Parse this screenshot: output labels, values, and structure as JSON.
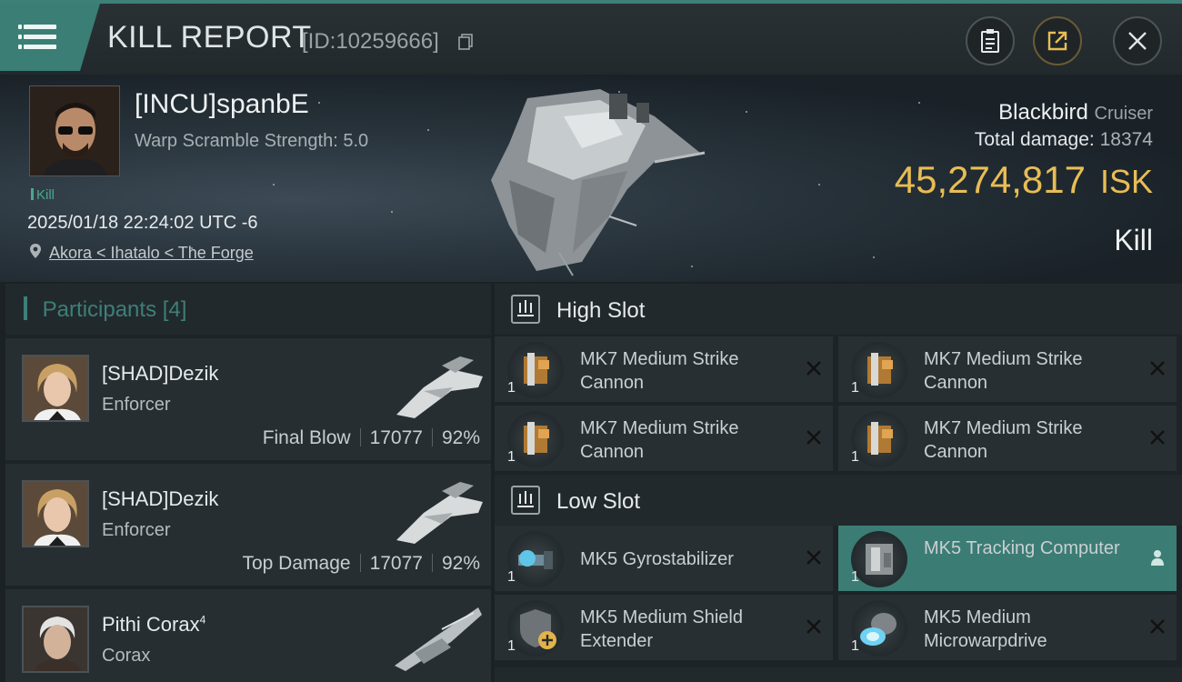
{
  "header": {
    "title": "KILL REPORT",
    "report_id": "[ID:10259666]"
  },
  "victim": {
    "name": "[INCU]spanbE",
    "scram": "Warp Scramble Strength: 5.0",
    "tag": "Kill",
    "timestamp": "2025/01/18 22:24:02 UTC -6",
    "location": "Akora < Ihatalo < The Forge",
    "ship": "Blackbird",
    "ship_class": "Cruiser",
    "total_damage_label": "Total damage:",
    "total_damage": "18374",
    "isk_value": "45,274,817",
    "isk_unit": "ISK",
    "result": "Kill"
  },
  "participants": {
    "label": "Participants",
    "count": "[4]",
    "items": [
      {
        "name": "[SHAD]Dezik",
        "sup": "",
        "ship": "Enforcer",
        "role": "Final Blow",
        "damage": "17077",
        "pct": "92%"
      },
      {
        "name": "[SHAD]Dezik",
        "sup": "",
        "ship": "Enforcer",
        "role": "Top Damage",
        "damage": "17077",
        "pct": "92%"
      },
      {
        "name": "Pithi Corax",
        "sup": "4",
        "ship": "Corax",
        "role": "",
        "damage": "",
        "pct": ""
      }
    ]
  },
  "slots": {
    "high": {
      "label": "High Slot",
      "modules": [
        {
          "name": "MK7 Medium Strike Cannon",
          "qty": "1"
        },
        {
          "name": "MK7 Medium Strike Cannon",
          "qty": "1"
        },
        {
          "name": "MK7 Medium Strike Cannon",
          "qty": "1"
        },
        {
          "name": "MK7 Medium Strike Cannon",
          "qty": "1"
        }
      ]
    },
    "low": {
      "label": "Low Slot",
      "modules": [
        {
          "name": "MK5 Gyrostabilizer",
          "qty": "1"
        },
        {
          "name": "MK5 Tracking Computer",
          "qty": "1"
        },
        {
          "name": "MK5 Medium Shield Extender",
          "qty": "1"
        },
        {
          "name": "MK5 Medium Microwarpdrive",
          "qty": "1"
        }
      ]
    }
  },
  "colors": {
    "accent": "#3c8078",
    "isk": "#e8bd55",
    "selected": "#3b7d74"
  }
}
